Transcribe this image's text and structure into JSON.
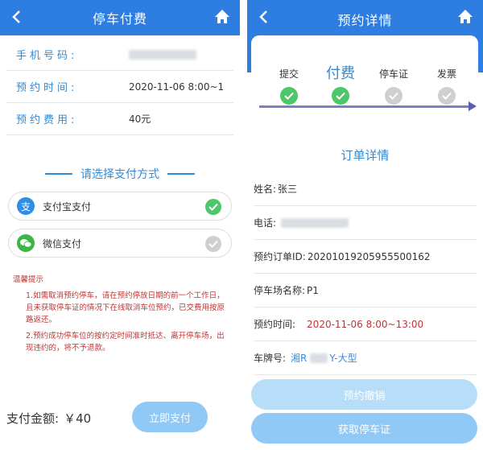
{
  "left": {
    "header_title": "停车付费",
    "info": {
      "phone_label": "手机号码:",
      "time_label": "预约时间:",
      "time_value": "2020-11-06 8:00~1",
      "fee_label": "预约费用:",
      "fee_value": "40元"
    },
    "pay_section_title": "请选择支付方式",
    "methods": [
      {
        "label": "支付宝支付",
        "icon": "alipay-icon",
        "selected": true
      },
      {
        "label": "微信支付",
        "icon": "wechat-icon",
        "selected": false
      }
    ],
    "tips": {
      "title": "温馨提示",
      "item1": "1.如需取消预约停车，请在预约停放日期的前一个工作日，且未获取停车证的情况下在线取消车位预约，已交费用按原路返还。",
      "item2": "2.预约成功停车位的按约定时间准时抵达、离开停车场，出现违约的，将不予退款。"
    },
    "amount_label": "支付金额:",
    "amount_value": "￥40",
    "pay_button": "立即支付"
  },
  "right": {
    "header_title": "预约详情",
    "steps": [
      {
        "label": "提交",
        "state": "done"
      },
      {
        "label": "付费",
        "state": "active"
      },
      {
        "label": "停车证",
        "state": "pending"
      },
      {
        "label": "发票",
        "state": "pending"
      }
    ],
    "order_title": "订单详情",
    "rows": {
      "name_label": "姓名:",
      "name_value": "张三",
      "phone_label": "电话:",
      "order_id_label": "预约订单ID:",
      "order_id_value": "20201019205955500162",
      "lot_label": "停车场名称:",
      "lot_value": "P1",
      "time_label": "预约时间:",
      "time_value": "2020-11-06 8:00~13:00",
      "plate_label": "车牌号:",
      "plate_prefix": "湘R",
      "plate_suffix": "Y-大型"
    },
    "cancel_button": "预约撤销",
    "get_button": "获取停车证"
  },
  "colors": {
    "primary": "#2e7de1",
    "accent_text": "#2e8bd9",
    "success": "#4cc76a",
    "pending": "#cfcfcf",
    "warning_text": "#c03535",
    "button_light": "#90c8f6"
  }
}
